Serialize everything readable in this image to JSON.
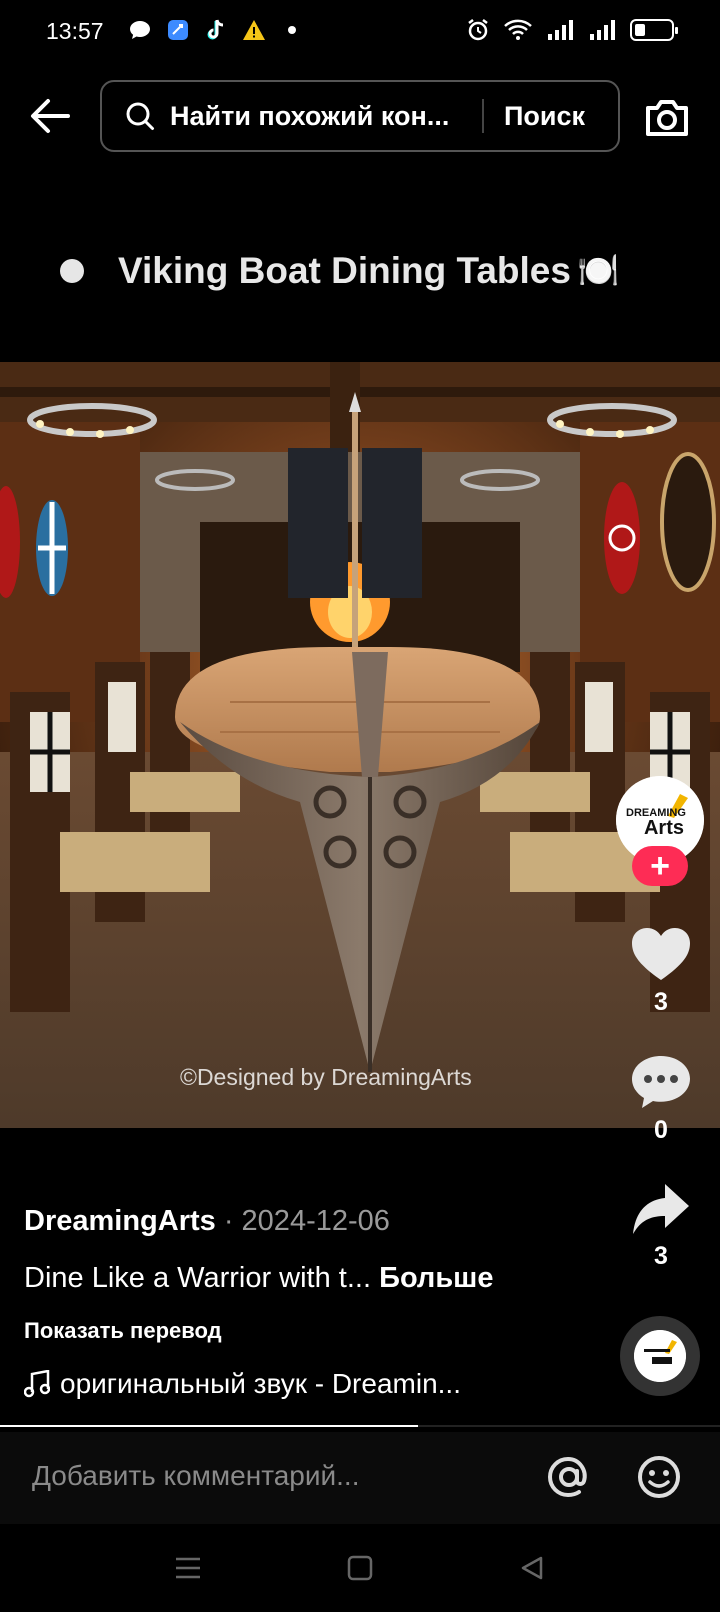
{
  "status_bar": {
    "time": "13:57"
  },
  "search": {
    "query": "Найти похожий кон...",
    "button_label": "Поиск"
  },
  "video": {
    "title": "Viking Boat Dining Tables",
    "title_emoji": "🍽️",
    "watermark": "©Designed by DreamingArts"
  },
  "actions": {
    "likes": "3",
    "comments": "0",
    "shares": "3",
    "follow_label": "+",
    "avatar_text_line1": "DREAMING",
    "avatar_text_line2": "Arts"
  },
  "post": {
    "author": "DreamingArts",
    "date": " · 2024-12-06",
    "caption": "Dine Like a Warrior with t... ",
    "more_label": "Больше",
    "translate_label": "Показать перевод",
    "sound": "оригинальный звук - Dreamin..."
  },
  "playback": {
    "progress": 0.58
  },
  "comment_bar": {
    "placeholder": "Добавить комментарий..."
  },
  "colors": {
    "accent": "#fe2c55",
    "background": "#000000"
  }
}
